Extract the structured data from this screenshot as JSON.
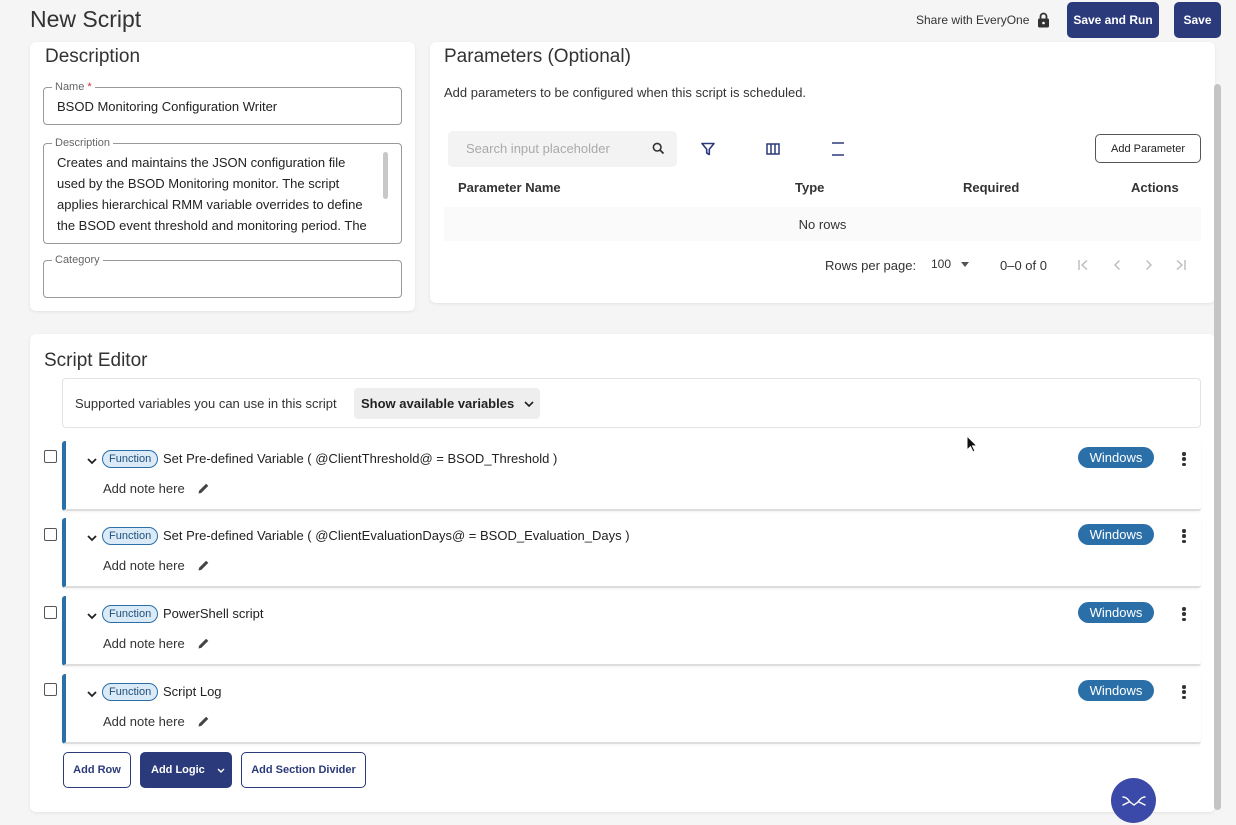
{
  "header": {
    "title": "New Script",
    "share_label": "Share with EveryOne",
    "save_and_run_label": "Save and Run",
    "save_label": "Save"
  },
  "description_card": {
    "title": "Description",
    "name_label": "Name",
    "name_required_mark": "*",
    "name_value": "BSOD Monitoring Configuration Writer",
    "description_label": "Description",
    "description_value": "Creates and maintains the JSON configuration file used by the BSOD Monitoring monitor. The script applies hierarchical RMM variable overrides to define the BSOD event threshold and monitoring period. The",
    "category_label": "Category",
    "category_value": ""
  },
  "parameters_card": {
    "title": "Parameters (Optional)",
    "subtitle": "Add parameters to be configured when this script is scheduled.",
    "search_placeholder": "Search input placeholder",
    "add_parameter_label": "Add Parameter",
    "columns": [
      "Parameter Name",
      "Type",
      "Required",
      "Actions"
    ],
    "empty_text": "No rows",
    "rows_per_page_label": "Rows per page:",
    "rows_per_page_value": "100",
    "range_text": "0–0 of 0"
  },
  "script_editor": {
    "title": "Script Editor",
    "vars_text": "Supported variables you can use in this script",
    "vars_button": "Show available variables",
    "rows": [
      {
        "badge": "Function",
        "title": "Set Pre-defined Variable ( @ClientThreshold@ = BSOD_Threshold )",
        "note": "Add note here",
        "os": "Windows"
      },
      {
        "badge": "Function",
        "title": "Set Pre-defined Variable ( @ClientEvaluationDays@ = BSOD_Evaluation_Days )",
        "note": "Add note here",
        "os": "Windows"
      },
      {
        "badge": "Function",
        "title": "PowerShell script",
        "note": "Add note here",
        "os": "Windows"
      },
      {
        "badge": "Function",
        "title": "Script Log",
        "note": "Add note here",
        "os": "Windows"
      }
    ],
    "add_row_label": "Add Row",
    "add_logic_label": "Add Logic",
    "add_section_divider_label": "Add Section Divider"
  },
  "colors": {
    "primary": "#2b3a7a",
    "accent_blue": "#2b6fa8",
    "fab": "#3b4aa8"
  }
}
